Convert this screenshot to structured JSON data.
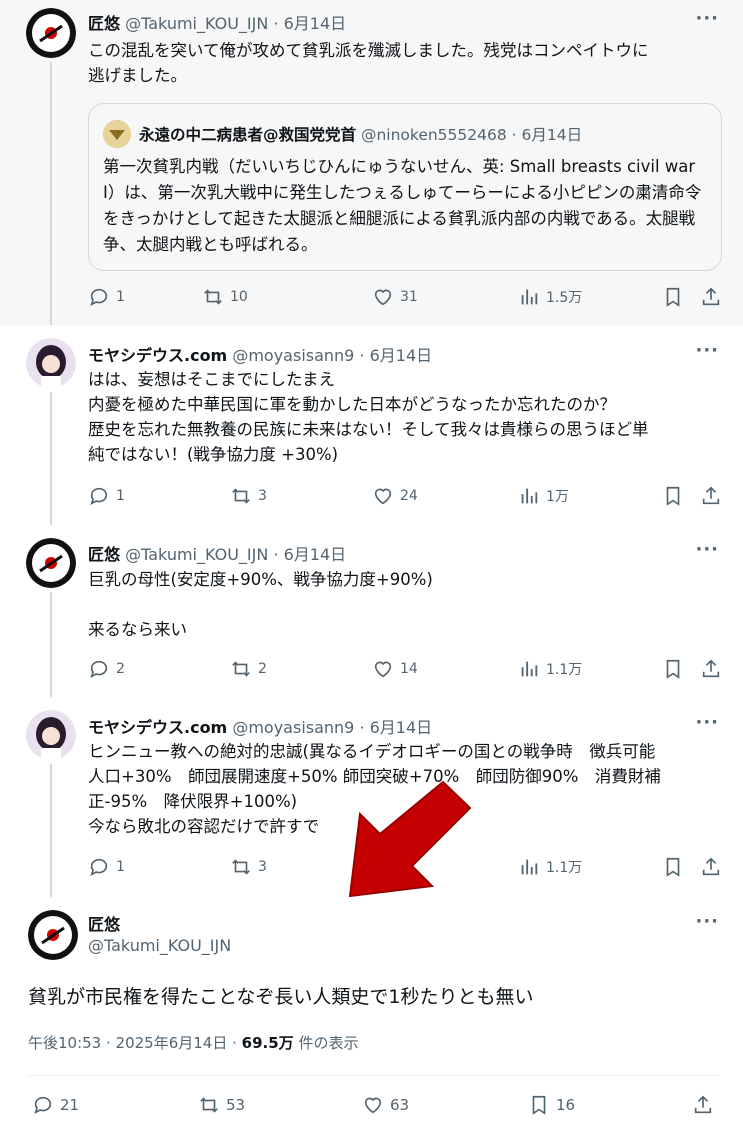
{
  "tweets": [
    {
      "name": "匠悠",
      "handle": "@Takumi_KOU_IJN",
      "date": "· 6月14日",
      "text": "この混乱を突いて俺が攻めて貧乳派を殲滅しました。残党はコンペイトウに\n逃げました。",
      "quote": {
        "name": "永遠の中二病患者@救国党党首",
        "handle": "@ninoken5552468",
        "date": "· 6月14日",
        "text": "第一次貧乳内戦（だいいちじひんにゅうないせん、英: Small breasts civil war Ⅰ）は、第一次乳大戦中に発生したつぇるしゅてーらーによる小ピピンの粛清命令をきっかけとして起きた太腿派と細腿派による貧乳派内部の内戦である。太腿戦争、太腿内戦とも呼ばれる。"
      },
      "replies": "1",
      "retweets": "10",
      "likes": "31",
      "views": "1.5万"
    },
    {
      "name": "モヤシデウス.com",
      "handle": "@moyasisann9",
      "date": "· 6月14日",
      "text": "はは、妄想はそこまでにしたまえ\n内憂を極めた中華民国に軍を動かした日本がどうなったか忘れたのか？\n歴史を忘れた無教養の民族に未来はない！そして我々は貴様らの思うほど単\n純ではない！(戦争協力度 +30%)",
      "replies": "1",
      "retweets": "3",
      "likes": "24",
      "views": "1万"
    },
    {
      "name": "匠悠",
      "handle": "@Takumi_KOU_IJN",
      "date": "· 6月14日",
      "text": "巨乳の母性(安定度+90%、戦争協力度+90%)\n\n来るなら来い",
      "replies": "2",
      "retweets": "2",
      "likes": "14",
      "views": "1.1万"
    },
    {
      "name": "モヤシデウス.com",
      "handle": "@moyasisann9",
      "date": "· 6月14日",
      "text": "ヒンニュー教への絶対的忠誠(異なるイデオロギーの国との戦争時　徴兵可能\n人口+30%　師団展開速度+50% 師団突破+70%　師団防御90%　消費財補\n正-95%　降伏限界+100%)\n今なら敗北の容認だけで許すで",
      "replies": "1",
      "retweets": "3",
      "likes": "",
      "views": "1.1万"
    }
  ],
  "main": {
    "name": "匠悠",
    "handle": "@Takumi_KOU_IJN",
    "text": "貧乳が市民権を得たことなぞ長い人類史で1秒たりとも無い",
    "time": "午後10:53 · 2025年6月14日 · ",
    "views": "69.5万",
    "views_suffix": " 件の表示",
    "replies": "21",
    "retweets": "53",
    "likes": "63",
    "bookmarks": "16"
  },
  "more_label": "···",
  "colors": {
    "arrow": "#c40000",
    "text_secondary": "#536471"
  }
}
